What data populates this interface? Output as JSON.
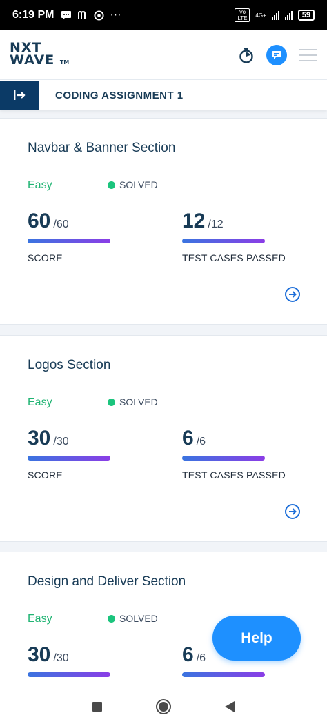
{
  "status_bar": {
    "time": "6:19 PM",
    "icons": [
      "message-icon",
      "m-app-icon",
      "chrome-icon",
      "more-icon"
    ],
    "more": "···",
    "network": "4G+",
    "volte": "Vo LTE",
    "battery": "59"
  },
  "header": {
    "logo_line1": "NXT",
    "logo_line2": "WAVE",
    "logo_tm": "TM",
    "icons": [
      "timer-icon",
      "chat-icon",
      "menu-icon"
    ]
  },
  "subheader": {
    "title": "CODING ASSIGNMENT 1",
    "toggle_icon": "sidebar-toggle-icon"
  },
  "cards": [
    {
      "title": "Navbar & Banner Section",
      "difficulty": "Easy",
      "status": "SOLVED",
      "score": "60",
      "score_total": "/60",
      "score_label": "SCORE",
      "tests": "12",
      "tests_total": "/12",
      "tests_label": "TEST CASES PASSED",
      "score_fraction": 1.0,
      "tests_fraction": 1.0
    },
    {
      "title": "Logos Section",
      "difficulty": "Easy",
      "status": "SOLVED",
      "score": "30",
      "score_total": "/30",
      "score_label": "SCORE",
      "tests": "6",
      "tests_total": "/6",
      "tests_label": "TEST CASES PASSED",
      "score_fraction": 1.0,
      "tests_fraction": 1.0
    },
    {
      "title": "Design and Deliver Section",
      "difficulty": "Easy",
      "status": "SOLVED",
      "score": "30",
      "score_total": "/30",
      "score_label": "",
      "tests": "6",
      "tests_total": "/6",
      "tests_label": "",
      "score_fraction": 1.0,
      "tests_fraction": 1.0
    }
  ],
  "help": {
    "label": "Help"
  },
  "colors": {
    "brand_navy": "#183b56",
    "accent_blue": "#1e90ff",
    "easy_green": "#20b473",
    "solved_dot": "#1bc47d",
    "bar_start": "#3a74e0",
    "bar_end": "#8b3de6"
  },
  "nav": {
    "icons": [
      "recents-square-icon",
      "home-circle-icon",
      "back-triangle-icon"
    ]
  }
}
